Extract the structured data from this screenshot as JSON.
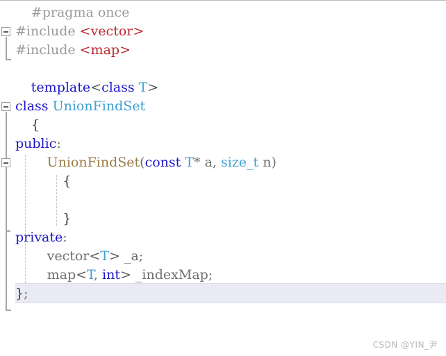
{
  "editor": {
    "language": "cpp",
    "background_color": "#ffffff",
    "current_line_highlight_color": "#e9eaf3",
    "colors": {
      "preprocessor": "#9a9a9a",
      "keyword": "#1d17c8",
      "type": "#3f9fd0",
      "string_include": "#b8292f",
      "function": "#9a7a44",
      "plain": "#6f6f6f",
      "fold_marker": "#9a9a9a"
    },
    "lines": [
      {
        "n": 1,
        "indent": 1,
        "tokens": [
          {
            "cls": "t-pre",
            "text": "#pragma once"
          }
        ]
      },
      {
        "n": 2,
        "indent": 0,
        "fold": "minus",
        "tokens": [
          {
            "cls": "t-pre",
            "text": "#include "
          },
          {
            "cls": "t-string",
            "text": "<vector>"
          }
        ]
      },
      {
        "n": 3,
        "indent": 0,
        "tokens": [
          {
            "cls": "t-pre",
            "text": "#include "
          },
          {
            "cls": "t-string",
            "text": "<map>"
          }
        ]
      },
      {
        "n": 4,
        "indent": 0,
        "tokens": []
      },
      {
        "n": 5,
        "indent": 1,
        "tokens": [
          {
            "cls": "t-key",
            "text": "template"
          },
          {
            "cls": "t-punct",
            "text": "<"
          },
          {
            "cls": "t-key",
            "text": "class"
          },
          {
            "cls": "t-plain",
            "text": " "
          },
          {
            "cls": "t-type",
            "text": "T"
          },
          {
            "cls": "t-punct",
            "text": ">"
          }
        ]
      },
      {
        "n": 6,
        "indent": 0,
        "fold": "minus",
        "tokens": [
          {
            "cls": "t-key",
            "text": "class"
          },
          {
            "cls": "t-plain",
            "text": " "
          },
          {
            "cls": "t-type",
            "text": "UnionFindSet"
          }
        ]
      },
      {
        "n": 7,
        "indent": 1,
        "tokens": [
          {
            "cls": "t-brace",
            "text": "{"
          }
        ]
      },
      {
        "n": 8,
        "indent": 0,
        "tokens": [
          {
            "cls": "t-key",
            "text": "public"
          },
          {
            "cls": "t-plain",
            "text": ":"
          }
        ]
      },
      {
        "n": 9,
        "indent": 2,
        "fold": "minus",
        "tokens": [
          {
            "cls": "t-func",
            "text": "UnionFindSet"
          },
          {
            "cls": "t-plain",
            "text": "("
          },
          {
            "cls": "t-key",
            "text": "const"
          },
          {
            "cls": "t-plain",
            "text": " "
          },
          {
            "cls": "t-type",
            "text": "T"
          },
          {
            "cls": "t-plain",
            "text": "* a, "
          },
          {
            "cls": "t-type",
            "text": "size_t"
          },
          {
            "cls": "t-plain",
            "text": " n)"
          }
        ]
      },
      {
        "n": 10,
        "indent": 3,
        "tokens": [
          {
            "cls": "t-brace",
            "text": "{"
          }
        ]
      },
      {
        "n": 11,
        "indent": 3,
        "tokens": []
      },
      {
        "n": 12,
        "indent": 3,
        "tokens": [
          {
            "cls": "t-brace",
            "text": "}"
          }
        ]
      },
      {
        "n": 13,
        "indent": 0,
        "tokens": [
          {
            "cls": "t-key",
            "text": "private"
          },
          {
            "cls": "t-plain",
            "text": ":"
          }
        ]
      },
      {
        "n": 14,
        "indent": 2,
        "tokens": [
          {
            "cls": "t-plain",
            "text": "vector"
          },
          {
            "cls": "t-punct",
            "text": "<"
          },
          {
            "cls": "t-type",
            "text": "T"
          },
          {
            "cls": "t-punct",
            "text": ">"
          },
          {
            "cls": "t-plain",
            "text": " _a;"
          }
        ]
      },
      {
        "n": 15,
        "indent": 2,
        "tokens": [
          {
            "cls": "t-plain",
            "text": "map"
          },
          {
            "cls": "t-punct",
            "text": "<"
          },
          {
            "cls": "t-type",
            "text": "T"
          },
          {
            "cls": "t-plain",
            "text": ", "
          },
          {
            "cls": "t-key",
            "text": "int"
          },
          {
            "cls": "t-punct",
            "text": ">"
          },
          {
            "cls": "t-plain",
            "text": " _indexMap;"
          }
        ]
      },
      {
        "n": 16,
        "indent": 0,
        "current": true,
        "tokens": [
          {
            "cls": "t-brace",
            "text": "}"
          },
          {
            "cls": "t-plain",
            "text": ";"
          }
        ]
      }
    ]
  },
  "watermark": {
    "text": "CSDN @YIN_尹"
  }
}
